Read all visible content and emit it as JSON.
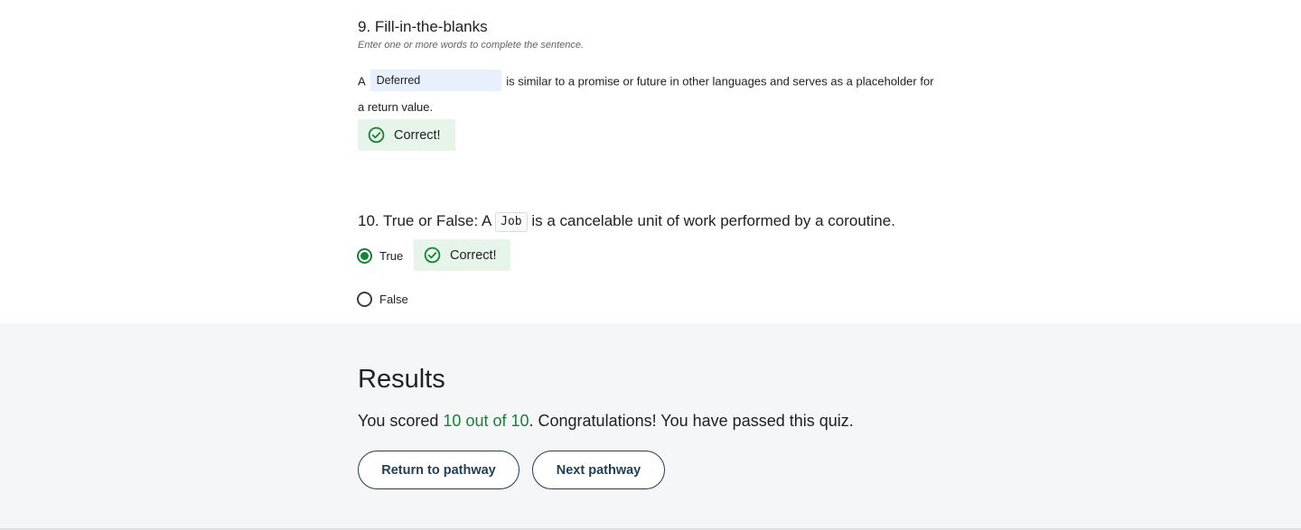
{
  "question9": {
    "title": "9. Fill-in-the-blanks",
    "hint": "Enter one or more words to complete the sentence.",
    "sentence_before": "A",
    "blank_value": "Deferred",
    "sentence_after_line1": "is similar to a promise or future in other languages and serves as a placeholder for",
    "sentence_line2": "a return value.",
    "feedback": "Correct!"
  },
  "question10": {
    "title_before": "10. True or False: A",
    "code": "Job",
    "title_after": "is a cancelable unit of work performed by a coroutine.",
    "options": [
      {
        "label": "True",
        "selected": true
      },
      {
        "label": "False",
        "selected": false
      }
    ],
    "feedback": "Correct!"
  },
  "results": {
    "title": "Results",
    "text_before": "You scored",
    "score": "10 out of 10",
    "text_after": ". Congratulations! You have passed this quiz.",
    "return_label": "Return to pathway",
    "next_label": "Next pathway"
  },
  "colors": {
    "success": "#188038",
    "success_bg": "#e6f4ea",
    "blank_bg": "#e8f0fe",
    "results_bg": "#f4f6f8",
    "button_border": "#1f3f55"
  },
  "icons": {
    "feedback": "check-circle-icon"
  }
}
